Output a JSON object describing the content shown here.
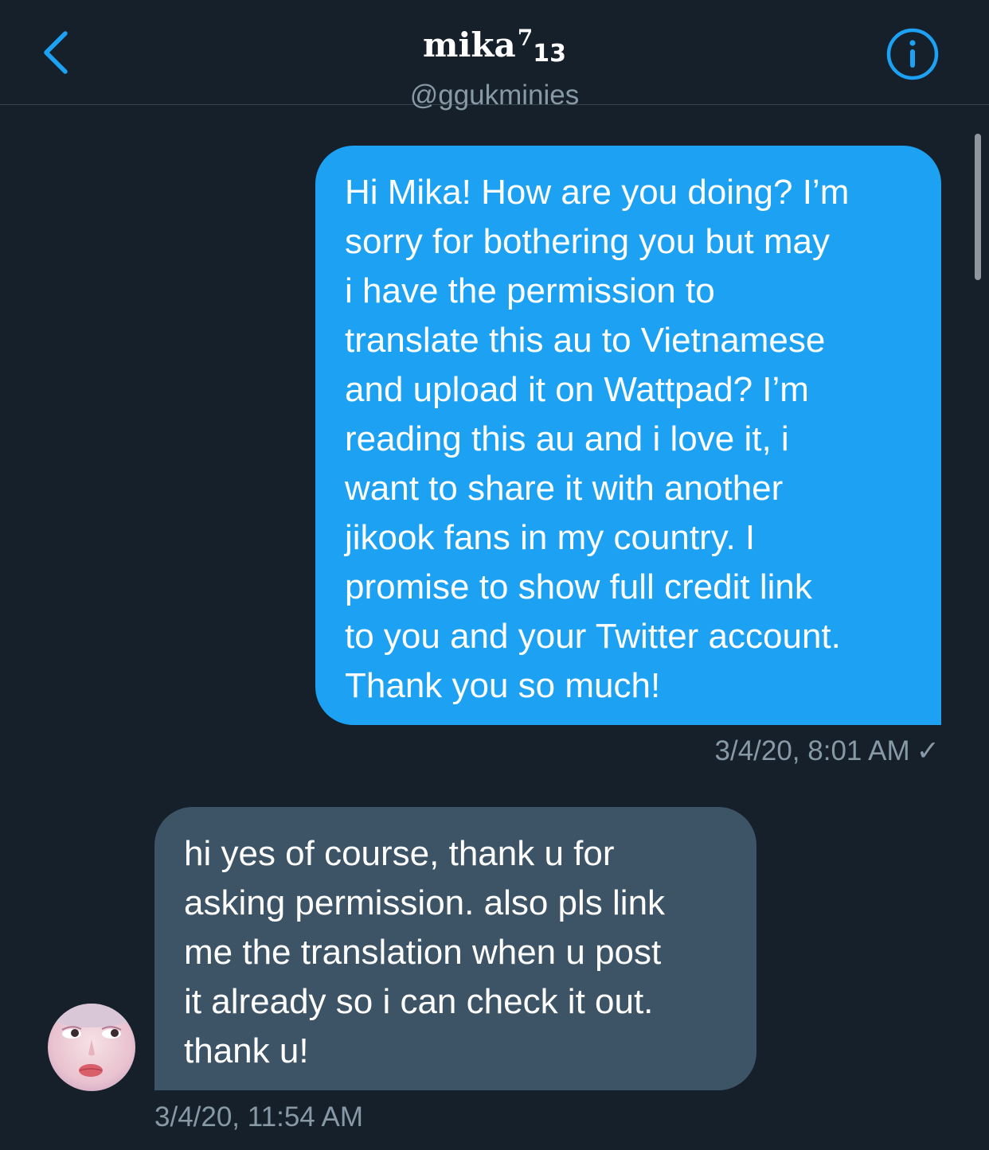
{
  "header": {
    "name": "mika",
    "name_superscript": "7",
    "name_subscript": "13",
    "handle": "@ggukminies",
    "back_icon": "chevron-left-icon",
    "info_icon": "info-circle-icon",
    "accent_color": "#1da1f2"
  },
  "messages": [
    {
      "direction": "outgoing",
      "text": "Hi Mika! How are you doing? I’m\nsorry for bothering you but may\ni have the permission to\ntranslate this au to Vietnamese\nand upload it on Wattpad? I’m\nreading this au and i love it, i\nwant to share it with another\njikook fans in my country. I\npromise to show full credit link\nto you and your Twitter account.\nThank you so much!",
      "timestamp": "3/4/20, 8:01 AM",
      "status_icon": "checkmark-icon",
      "status_glyph": "✓",
      "bubble_color": "#1da1f2"
    },
    {
      "direction": "incoming",
      "text": "hi yes of course, thank u for\nasking permission. also pls link\nme the translation when u post\nit already so i can check it out.\nthank u!",
      "timestamp": "3/4/20, 11:54 AM",
      "bubble_color": "#3d5466"
    }
  ],
  "theme": {
    "background": "#15202b",
    "secondary_text": "#8899a6",
    "divider": "#38444d"
  }
}
